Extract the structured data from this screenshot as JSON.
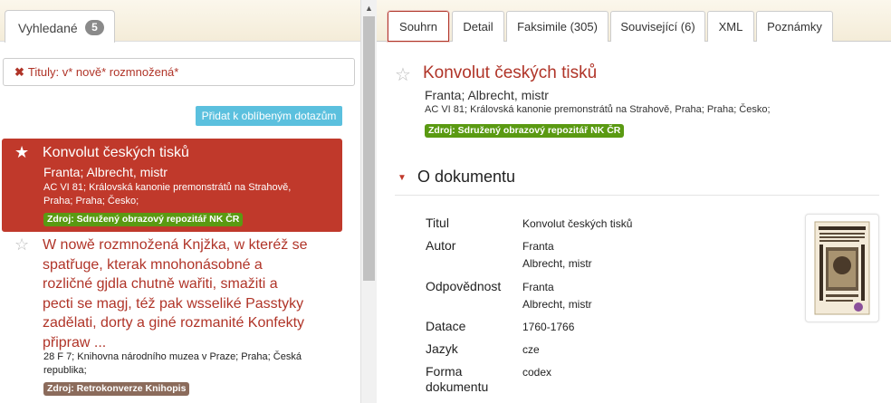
{
  "left": {
    "tab_label": "Vyhledané",
    "tab_count": "5",
    "query_text": "Tituly: v* nově* rozmnožená*",
    "fav_button": "Přidat k oblíbeným dotazům",
    "results": [
      {
        "title": "Konvolut českých tisků",
        "author": "Franta; Albrecht, mistr",
        "meta_line1": "AC VI 81; Královská kanonie premonstrátů na Strahově,",
        "meta_line2": "Praha; Praha; Česko;",
        "source": "Zdroj: Sdružený obrazový repozitář NK ČR"
      },
      {
        "title_lines": [
          "W nowě rozmnožená Knjžka, w kteréž se",
          "spatřuge, kterak mnohonásobné a",
          "rozličné gjdla chutně wařiti, smažiti a",
          "pecti se magj, též pak wsseliké Passtyky",
          "zadělati, dorty a giné rozmanité Konfekty",
          "připraw ..."
        ],
        "meta_line1": "28 F 7; Knihovna národního muzea v Praze; Praha; Česká",
        "meta_line2": "republika;",
        "source": "Zdroj: Retrokonverze Knihopis"
      }
    ]
  },
  "right": {
    "tabs": [
      "Souhrn",
      "Detail",
      "Faksimile (305)",
      "Související (6)",
      "XML",
      "Poznámky"
    ],
    "title": "Konvolut českých tisků",
    "author": "Franta; Albrecht, mistr",
    "meta": "AC VI 81; Královská kanonie premonstrátů na Strahově, Praha; Praha; Česko;",
    "source": "Zdroj: Sdružený obrazový repozitář NK ČR",
    "section_title": "O dokumentu",
    "fields": [
      {
        "label": "Titul",
        "values": [
          "Konvolut českých tisků"
        ]
      },
      {
        "label": "Autor",
        "values": [
          "Franta",
          "Albrecht, mistr"
        ]
      },
      {
        "label": "Odpovědnost",
        "values": [
          "Franta",
          "Albrecht, mistr"
        ]
      },
      {
        "label": "Datace",
        "values": [
          "1760-1766"
        ]
      },
      {
        "label": "Jazyk",
        "values": [
          "cze"
        ]
      },
      {
        "label": "Forma dokumentu",
        "values": [
          "codex"
        ]
      }
    ]
  },
  "colors": {
    "accent_red": "#b03428",
    "selected_bg": "#c0392b",
    "source_green": "#5a9a12",
    "source_brown": "#8b6b5b",
    "button_blue": "#5bc0de"
  },
  "icons": {
    "remove": "x-icon",
    "favorite_filled": "star-filled-icon",
    "favorite_empty": "star-outline-icon",
    "section_toggle": "caret-down-icon"
  }
}
